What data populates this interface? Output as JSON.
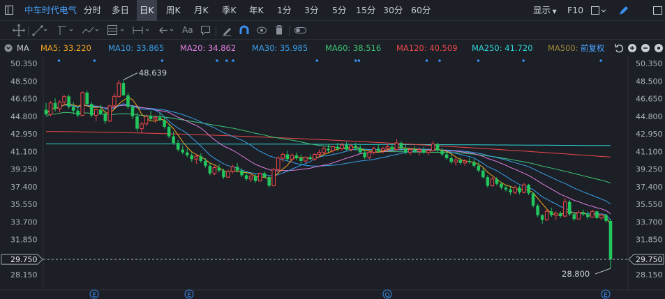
{
  "toolbar": {
    "stock_name": "中车时代电气",
    "timeframes": [
      "分时",
      "多日",
      "日K",
      "周K",
      "月K",
      "季K",
      "年K",
      "1分",
      "3分",
      "5分",
      "15分",
      "30分",
      "60分"
    ],
    "active_timeframe": "日K",
    "display_label": "显示",
    "f10_label": "F10",
    "icons": [
      "layout-toggle-icon",
      "checkbox-icon",
      "pen-icon",
      "window-icon"
    ]
  },
  "drawing_tools": [
    "crosshair-icon",
    "line-tool-icon",
    "ray-tool-icon",
    "pattern-tool-icon",
    "fib-tool-icon",
    "measure-tool-icon",
    "arrow-back-icon",
    "text-tool-icon",
    "comment-icon",
    "eraser-icon",
    "magnet-icon",
    "eye-icon",
    "trash-icon",
    "toggle-icon"
  ],
  "text_tool_label": "Aa",
  "ma_bar": {
    "label": "MA",
    "items": [
      {
        "label": "MA5: 33.220",
        "color": "#f5a623"
      },
      {
        "label": "MA10: 33.865",
        "color": "#3aa0e8"
      },
      {
        "label": "MA20: 34.862",
        "color": "#e27fe0"
      },
      {
        "label": "MA30: 35.985",
        "color": "#3aa0e8"
      },
      {
        "label": "MA60: 38.516",
        "color": "#3ec774"
      },
      {
        "label": "MA120: 40.509",
        "color": "#f0484a"
      },
      {
        "label": "MA250: 41.720",
        "color": "#2ed6d6"
      },
      {
        "label": "MA500:",
        "color": "#a08a3a"
      }
    ],
    "adjust_label": "前复权"
  },
  "chart_data": {
    "type": "candlestick",
    "ylim": [
      26.9,
      51.1
    ],
    "y_ticks": [
      "50.350",
      "48.500",
      "46.650",
      "44.800",
      "42.950",
      "41.100",
      "39.250",
      "37.400",
      "35.550",
      "33.700",
      "31.850",
      "29.750",
      "28.150"
    ],
    "current_price": "29.750",
    "annotations": {
      "high": "48.639",
      "low": "28.800"
    },
    "event_markers": [
      "E",
      "E",
      "Q",
      "E"
    ],
    "candles": [
      [
        45.5,
        46.2,
        44.9,
        45.0
      ],
      [
        45.0,
        46.4,
        44.8,
        46.2
      ],
      [
        46.2,
        46.7,
        45.3,
        45.6
      ],
      [
        45.6,
        46.5,
        45.2,
        46.3
      ],
      [
        46.3,
        47.0,
        46.0,
        46.9
      ],
      [
        46.9,
        47.1,
        45.6,
        45.8
      ],
      [
        45.8,
        46.3,
        45.0,
        45.4
      ],
      [
        45.4,
        45.9,
        44.7,
        44.9
      ],
      [
        44.9,
        47.4,
        44.8,
        47.3
      ],
      [
        47.3,
        47.5,
        46.0,
        46.1
      ],
      [
        46.1,
        46.3,
        44.7,
        44.9
      ],
      [
        44.9,
        45.6,
        44.3,
        45.5
      ],
      [
        45.5,
        46.0,
        44.9,
        45.1
      ],
      [
        45.1,
        45.5,
        44.0,
        44.3
      ],
      [
        44.3,
        46.0,
        44.2,
        45.9
      ],
      [
        45.9,
        47.2,
        45.7,
        46.9
      ],
      [
        46.9,
        48.6,
        46.7,
        48.3
      ],
      [
        48.3,
        48.64,
        47.0,
        47.0
      ],
      [
        47.0,
        47.3,
        45.6,
        45.8
      ],
      [
        45.8,
        46.0,
        44.5,
        44.8
      ],
      [
        44.8,
        45.2,
        43.2,
        43.5
      ],
      [
        43.5,
        44.2,
        43.0,
        44.0
      ],
      [
        44.0,
        45.0,
        43.8,
        44.8
      ],
      [
        44.8,
        45.4,
        44.3,
        44.5
      ],
      [
        44.5,
        44.9,
        44.1,
        44.7
      ],
      [
        44.7,
        45.2,
        44.3,
        44.4
      ],
      [
        44.4,
        44.8,
        43.5,
        43.7
      ],
      [
        43.7,
        44.0,
        42.5,
        42.7
      ],
      [
        42.7,
        43.2,
        41.8,
        42.0
      ],
      [
        42.0,
        42.3,
        41.1,
        41.3
      ],
      [
        41.3,
        41.7,
        40.8,
        41.0
      ],
      [
        41.0,
        41.4,
        40.5,
        40.7
      ],
      [
        40.7,
        41.0,
        40.0,
        40.3
      ],
      [
        40.3,
        40.8,
        39.8,
        40.6
      ],
      [
        40.6,
        40.9,
        39.9,
        40.1
      ],
      [
        40.1,
        40.4,
        39.4,
        39.6
      ],
      [
        39.6,
        39.9,
        38.6,
        38.8
      ],
      [
        38.8,
        39.6,
        38.6,
        39.4
      ],
      [
        39.4,
        39.8,
        38.9,
        39.1
      ],
      [
        39.1,
        39.3,
        38.2,
        38.4
      ],
      [
        38.4,
        39.2,
        38.3,
        39.0
      ],
      [
        39.0,
        39.7,
        38.8,
        39.5
      ],
      [
        39.5,
        39.9,
        38.9,
        39.1
      ],
      [
        39.1,
        39.3,
        38.4,
        38.6
      ],
      [
        38.6,
        38.9,
        38.0,
        38.2
      ],
      [
        38.2,
        38.7,
        37.9,
        38.5
      ],
      [
        38.5,
        38.8,
        37.8,
        38.0
      ],
      [
        38.0,
        38.9,
        37.9,
        38.8
      ],
      [
        38.8,
        39.0,
        38.3,
        38.4
      ],
      [
        38.4,
        38.6,
        37.3,
        37.5
      ],
      [
        37.5,
        39.4,
        37.4,
        39.2
      ],
      [
        39.2,
        40.6,
        39.0,
        40.4
      ],
      [
        40.4,
        41.0,
        40.0,
        40.8
      ],
      [
        40.8,
        41.2,
        40.1,
        40.3
      ],
      [
        40.3,
        40.9,
        40.0,
        40.7
      ],
      [
        40.7,
        41.0,
        40.2,
        40.4
      ],
      [
        40.4,
        40.8,
        39.8,
        40.1
      ],
      [
        40.1,
        40.6,
        39.9,
        40.5
      ],
      [
        40.5,
        40.8,
        40.2,
        40.3
      ],
      [
        40.3,
        40.9,
        40.1,
        40.8
      ],
      [
        40.8,
        41.3,
        40.5,
        41.0
      ],
      [
        41.0,
        41.6,
        40.8,
        41.4
      ],
      [
        41.4,
        41.9,
        41.0,
        41.2
      ],
      [
        41.2,
        41.7,
        41.0,
        41.6
      ],
      [
        41.6,
        42.0,
        41.2,
        41.4
      ],
      [
        41.4,
        42.0,
        41.2,
        41.8
      ],
      [
        41.8,
        42.1,
        41.2,
        41.3
      ],
      [
        41.3,
        41.9,
        41.1,
        41.7
      ],
      [
        41.7,
        42.0,
        41.3,
        41.5
      ],
      [
        41.5,
        41.8,
        40.9,
        41.0
      ],
      [
        41.0,
        41.4,
        40.3,
        40.5
      ],
      [
        40.5,
        41.2,
        40.3,
        41.0
      ],
      [
        41.0,
        41.6,
        40.8,
        41.4
      ],
      [
        41.4,
        41.8,
        41.0,
        41.2
      ],
      [
        41.2,
        41.6,
        40.9,
        41.4
      ],
      [
        41.4,
        41.9,
        41.1,
        41.6
      ],
      [
        41.6,
        41.9,
        41.2,
        41.3
      ],
      [
        41.3,
        42.4,
        41.2,
        42.0
      ],
      [
        42.0,
        42.2,
        41.2,
        41.4
      ],
      [
        41.4,
        41.8,
        40.8,
        41.0
      ],
      [
        41.0,
        41.5,
        40.7,
        41.3
      ],
      [
        41.3,
        41.7,
        40.9,
        41.1
      ],
      [
        41.1,
        41.5,
        40.7,
        41.3
      ],
      [
        41.3,
        41.6,
        40.8,
        41.0
      ],
      [
        41.0,
        41.4,
        40.7,
        41.2
      ],
      [
        41.2,
        42.2,
        41.1,
        41.9
      ],
      [
        41.9,
        42.0,
        41.0,
        41.2
      ],
      [
        41.2,
        41.5,
        40.6,
        40.8
      ],
      [
        40.8,
        41.2,
        40.2,
        40.4
      ],
      [
        40.4,
        40.8,
        39.8,
        40.0
      ],
      [
        40.0,
        40.4,
        39.6,
        40.2
      ],
      [
        40.2,
        40.5,
        39.7,
        39.9
      ],
      [
        39.9,
        40.3,
        39.6,
        40.1
      ],
      [
        40.1,
        40.4,
        39.8,
        40.0
      ],
      [
        40.0,
        40.3,
        39.4,
        39.6
      ],
      [
        39.6,
        40.0,
        38.9,
        39.1
      ],
      [
        39.1,
        39.4,
        38.2,
        38.4
      ],
      [
        38.4,
        38.6,
        37.3,
        37.5
      ],
      [
        37.5,
        38.4,
        37.4,
        38.2
      ],
      [
        38.2,
        38.4,
        37.5,
        37.7
      ],
      [
        37.7,
        37.9,
        37.1,
        37.3
      ],
      [
        37.3,
        37.6,
        36.9,
        37.1
      ],
      [
        37.1,
        37.4,
        36.5,
        36.8
      ],
      [
        36.8,
        37.5,
        36.6,
        37.3
      ],
      [
        37.3,
        37.5,
        36.6,
        36.8
      ],
      [
        36.8,
        37.8,
        36.7,
        37.6
      ],
      [
        37.6,
        37.7,
        36.5,
        36.7
      ],
      [
        36.7,
        36.8,
        35.2,
        35.4
      ],
      [
        35.4,
        35.6,
        34.2,
        34.4
      ],
      [
        34.4,
        34.5,
        33.5,
        33.9
      ],
      [
        33.9,
        35.0,
        33.8,
        34.8
      ],
      [
        34.8,
        35.2,
        34.2,
        34.4
      ],
      [
        34.4,
        34.8,
        33.9,
        34.6
      ],
      [
        34.6,
        34.8,
        34.1,
        34.3
      ],
      [
        34.3,
        36.2,
        34.2,
        35.8
      ],
      [
        35.8,
        36.0,
        34.3,
        34.5
      ],
      [
        34.5,
        34.7,
        33.8,
        34.0
      ],
      [
        34.0,
        34.9,
        33.9,
        34.7
      ],
      [
        34.7,
        35.0,
        34.3,
        34.5
      ],
      [
        34.5,
        34.8,
        34.0,
        34.2
      ],
      [
        34.2,
        35.0,
        34.1,
        34.8
      ],
      [
        34.8,
        34.9,
        34.0,
        34.1
      ],
      [
        34.1,
        34.6,
        33.9,
        34.4
      ],
      [
        34.4,
        34.5,
        33.6,
        33.8
      ],
      [
        33.8,
        34.0,
        28.8,
        29.75
      ]
    ]
  }
}
